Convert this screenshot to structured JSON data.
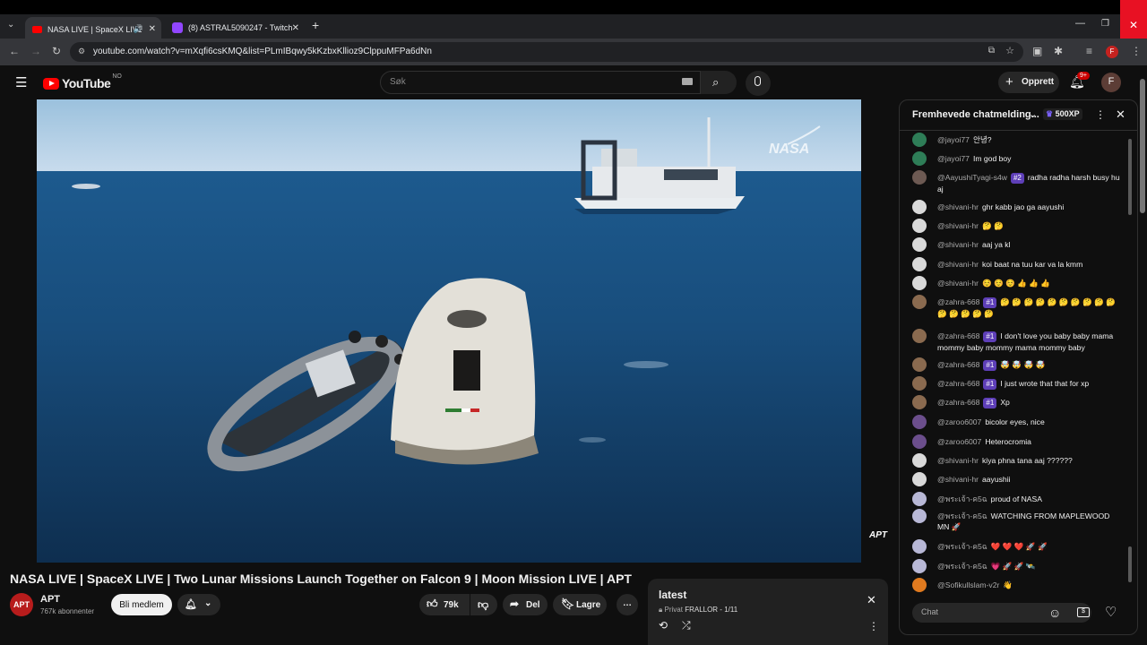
{
  "browser": {
    "tabs": [
      {
        "title": "NASA LIVE | SpaceX LIVE | T",
        "active": true
      },
      {
        "title": "(8) ASTRAL5090247 - Twitch",
        "active": false
      }
    ],
    "new_tab": "+",
    "url": "youtube.com/watch?v=mXqfi6csKMQ&list=PLmIBqwy5kKzbxKllioz9ClppuMFPa6dNn",
    "profile_initial": "F"
  },
  "youtube": {
    "logo": "YouTube",
    "region": "NO",
    "search_placeholder": "Søk",
    "create_label": "Opprett",
    "notif_count": "9+",
    "avatar_initial": "F"
  },
  "video": {
    "watermark": "NASA",
    "channel_bug": "APT",
    "title": "NASA LIVE | SpaceX LIVE | Two Lunar Missions Launch Together on Falcon 9 | Moon Mission LIVE | APT",
    "channel_name": "APT",
    "subscribers": "767k abonnenter",
    "join_label": "Bli medlem",
    "likes": "79k",
    "share_label": "Del",
    "save_label": "Lagre",
    "more": "…"
  },
  "playlist": {
    "title": "latest",
    "privacy": "Privat",
    "info": "FRALLOR - 1/11"
  },
  "chat": {
    "header": "Fremhevede chatmelding...",
    "xp": "500XP",
    "input_placeholder": "Chat",
    "messages": [
      {
        "author": "@jayoi77",
        "text": "안녕?",
        "badge": "",
        "avatar_color": "#2e7d57"
      },
      {
        "author": "@jayoi77",
        "text": "Im god boy",
        "badge": "",
        "avatar_color": "#2e7d57"
      },
      {
        "author": "@AayushiTyagi-s4w",
        "text": "radha radha harsh busy hu aj",
        "badge": "#2",
        "avatar_color": "#6d5a53"
      },
      {
        "author": "@shivani-hr",
        "text": "ghr kabb jao ga aayushi",
        "badge": "",
        "avatar_color": "#d9d9d9"
      },
      {
        "author": "@shivani-hr",
        "text": "🤔 🤔",
        "badge": "",
        "avatar_color": "#d9d9d9"
      },
      {
        "author": "@shivani-hr",
        "text": "aaj ya kl",
        "badge": "",
        "avatar_color": "#d9d9d9"
      },
      {
        "author": "@shivani-hr",
        "text": "koi baat na tuu kar va la kmm",
        "badge": "",
        "avatar_color": "#d9d9d9"
      },
      {
        "author": "@shivani-hr",
        "text": "☺️ ☺️ ☺️ 👍 👍 👍",
        "badge": "",
        "avatar_color": "#d9d9d9"
      },
      {
        "author": "@zahra-668",
        "text": "🤔 🤔 🤔 🤔 🤔 🤔 🤔 🤔 🤔 🤔 🤔 🤔 🤔 🤔 🤔",
        "badge": "#1",
        "avatar_color": "#8a6a4f"
      },
      {
        "author": "@zahra-668",
        "text": "I don't love you baby baby mama mommy baby mommy mama mommy baby",
        "badge": "#1",
        "avatar_color": "#8a6a4f"
      },
      {
        "author": "@zahra-668",
        "text": "🤯 🤯 🤯 🤯",
        "badge": "#1",
        "avatar_color": "#8a6a4f"
      },
      {
        "author": "@zahra-668",
        "text": "I just wrote that that for xp",
        "badge": "#1",
        "avatar_color": "#8a6a4f"
      },
      {
        "author": "@zahra-668",
        "text": "Xp",
        "badge": "#1",
        "avatar_color": "#8a6a4f"
      },
      {
        "author": "@zaroo6007",
        "text": "bicolor eyes, nice",
        "badge": "",
        "avatar_color": "#6b4e8c"
      },
      {
        "author": "@zaroo6007",
        "text": "Heterocromia",
        "badge": "",
        "avatar_color": "#6b4e8c"
      },
      {
        "author": "@shivani-hr",
        "text": "kiya phna tana aaj ??????",
        "badge": "",
        "avatar_color": "#d9d9d9"
      },
      {
        "author": "@shivani-hr",
        "text": "aayushii",
        "badge": "",
        "avatar_color": "#d9d9d9"
      },
      {
        "author": "@พระเจ้า-ค5ฉ",
        "text": "proud of NASA",
        "badge": "",
        "avatar_color": "#b8b8d6"
      },
      {
        "author": "@พระเจ้า-ค5ฉ",
        "text": "WATCHING FROM MAPLEWOOD MN 🚀",
        "badge": "",
        "avatar_color": "#b8b8d6"
      },
      {
        "author": "@พระเจ้า-ค5ฉ",
        "text": "❤️ ❤️ ❤️ 🚀 🚀",
        "badge": "",
        "avatar_color": "#b8b8d6"
      },
      {
        "author": "@พระเจ้า-ค5ฉ",
        "text": "💗 🚀 🚀 🛰️",
        "badge": "",
        "avatar_color": "#b8b8d6"
      },
      {
        "author": "@Sofikullslam-v2r",
        "text": "👋",
        "badge": "",
        "avatar_color": "#e07a1f"
      }
    ]
  },
  "colors": {
    "yt_red": "#ff0000",
    "close_red": "#e81123",
    "badge_purple": "#5e3fb8"
  }
}
